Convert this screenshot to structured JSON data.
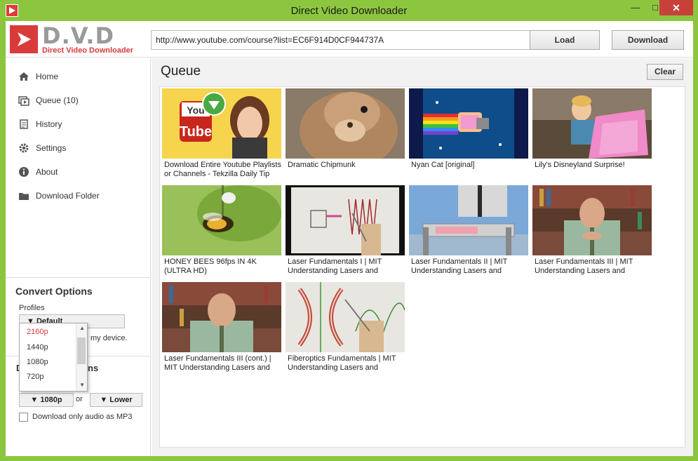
{
  "window": {
    "title": "Direct Video Downloader"
  },
  "logo": {
    "short": "D.V.D",
    "full": "Direct Video Downloader"
  },
  "toolbar": {
    "url_value": "http://www.youtube.com/course?list=EC6F914D0CF944737A",
    "load_label": "Load",
    "download_label": "Download"
  },
  "sidebar": {
    "items": [
      {
        "label": "Home",
        "icon": "home-icon"
      },
      {
        "label": "Queue (10)",
        "icon": "queue-icon"
      },
      {
        "label": "History",
        "icon": "history-icon"
      },
      {
        "label": "Settings",
        "icon": "gear-icon"
      },
      {
        "label": "About",
        "icon": "info-icon"
      },
      {
        "label": "Download Folder",
        "icon": "folder-icon"
      }
    ]
  },
  "convert": {
    "title": "Convert Options",
    "profiles_label": "Profiles",
    "profile_selected": "Default",
    "device_text": "my device."
  },
  "download_options": {
    "title_fragment": "ns",
    "quality": "1080p",
    "or": "or",
    "lower": "Lower",
    "mp3_label": "Download only audio as MP3"
  },
  "dropdown": {
    "options": [
      "2160p",
      "1440p",
      "1080p",
      "720p"
    ],
    "highlight_color": "#d93b3b"
  },
  "queue": {
    "title": "Queue",
    "clear_label": "Clear",
    "items": [
      {
        "title": "Download Entire Youtube Playlists or Channels - Tekzilla Daily Tip"
      },
      {
        "title": "Dramatic Chipmunk"
      },
      {
        "title": "Nyan Cat [original]"
      },
      {
        "title": "Lily's Disneyland Surprise!"
      },
      {
        "title": "HONEY BEES 96fps IN 4K (ULTRA HD)"
      },
      {
        "title": "Laser Fundamentals I | MIT Understanding Lasers and"
      },
      {
        "title": "Laser Fundamentals II | MIT Understanding Lasers and"
      },
      {
        "title": "Laser Fundamentals III | MIT Understanding Lasers and"
      },
      {
        "title": "Laser Fundamentals III (cont.) | MIT Understanding Lasers and"
      },
      {
        "title": "Fiberoptics Fundamentals | MIT Understanding Lasers and"
      }
    ]
  },
  "colors": {
    "frame": "#8cc63f",
    "accent": "#d93b3b"
  }
}
